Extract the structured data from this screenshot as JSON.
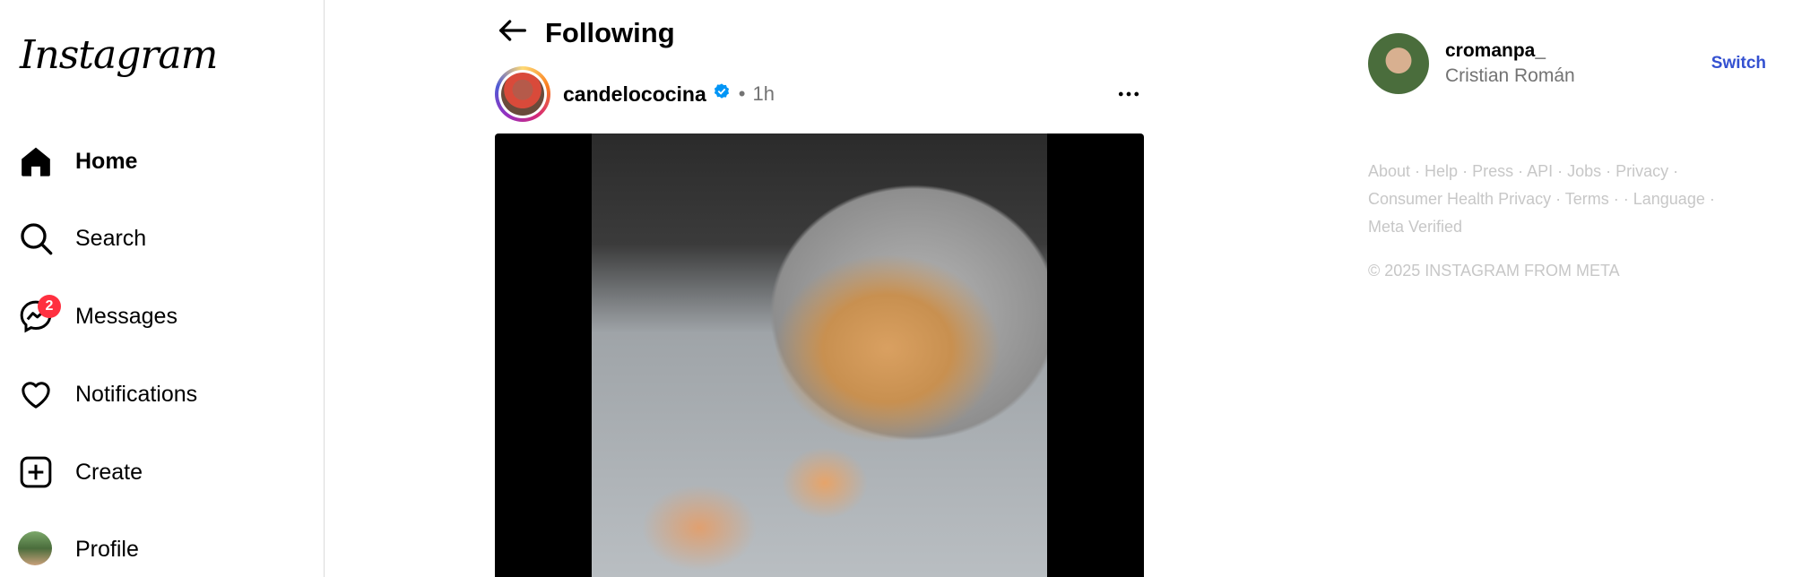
{
  "sidebar": {
    "logo": "Instagram",
    "items": [
      {
        "label": "Home",
        "icon": "home-icon"
      },
      {
        "label": "Search",
        "icon": "search-icon"
      },
      {
        "label": "Messages",
        "icon": "messenger-icon",
        "badge": "2"
      },
      {
        "label": "Notifications",
        "icon": "heart-icon"
      },
      {
        "label": "Create",
        "icon": "plus-square-icon"
      },
      {
        "label": "Profile",
        "icon": "avatar"
      }
    ]
  },
  "feed": {
    "title": "Following",
    "post": {
      "username": "candelococina",
      "verified": true,
      "separator": "•",
      "time": "1h"
    }
  },
  "right": {
    "username": "cromanpa_",
    "full_name": "Cristian Román",
    "switch_label": "Switch",
    "footer": {
      "links": [
        "About",
        "Help",
        "Press",
        "API",
        "Jobs",
        "Privacy",
        "Consumer Health Privacy",
        "Terms",
        "",
        "Language",
        "Meta Verified"
      ],
      "copyright": "© 2025 INSTAGRAM FROM META"
    }
  },
  "colors": {
    "accent": "#0095f6",
    "badge": "#ff3040",
    "muted": "#737373",
    "footer": "#c7c7c7",
    "switch": "#3451d1"
  }
}
